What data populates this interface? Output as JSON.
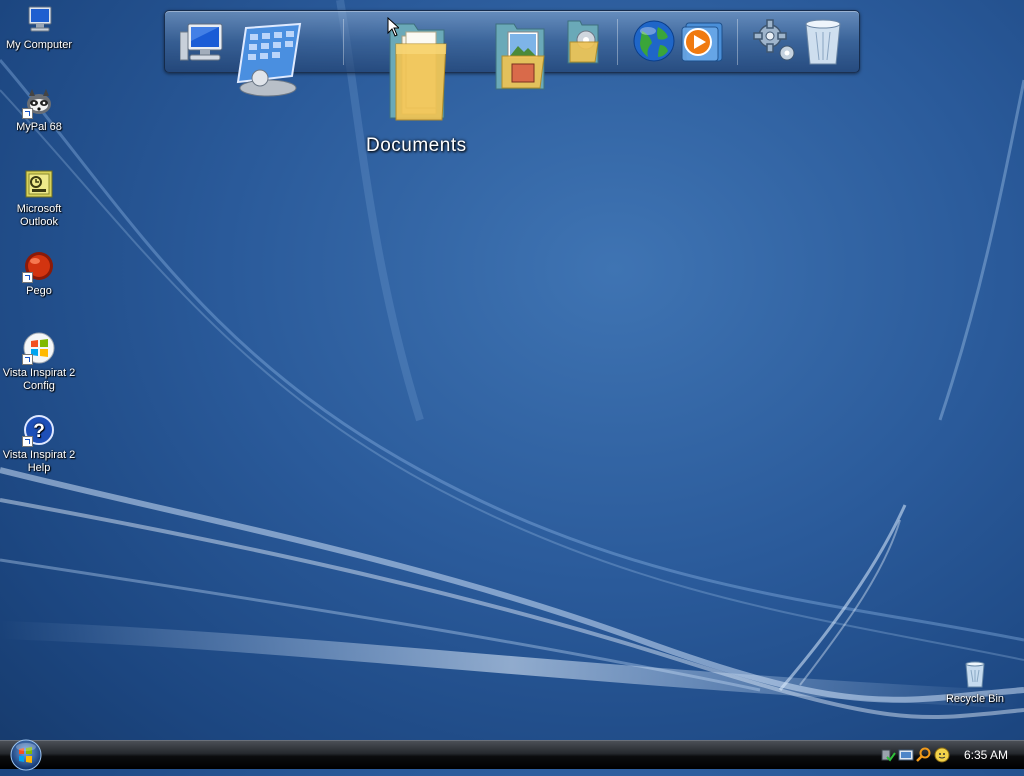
{
  "desktop": {
    "icons": [
      {
        "label": "My Computer",
        "icon": "computer-icon"
      },
      {
        "label": "MyPal 68",
        "icon": "raccoon-icon"
      },
      {
        "label": "Microsoft Outlook",
        "icon": "outlook-icon"
      },
      {
        "label": "Pego",
        "icon": "pego-ball-icon"
      },
      {
        "label": "Vista Inspirat 2 Config",
        "icon": "windows-logo-icon"
      },
      {
        "label": "Vista Inspirat 2 Help",
        "icon": "help-icon"
      }
    ],
    "recycle_bin": {
      "label": "Recycle Bin",
      "icon": "recycle-bin-icon"
    }
  },
  "dock": {
    "items": [
      {
        "name": "computer",
        "icon": "computer-icon"
      },
      {
        "name": "control-panel",
        "icon": "control-panel-icon"
      },
      {
        "name": "documents",
        "icon": "documents-folder-icon"
      },
      {
        "name": "pictures",
        "icon": "pictures-folder-icon"
      },
      {
        "name": "music",
        "icon": "music-folder-icon"
      },
      {
        "name": "internet",
        "icon": "globe-icon"
      },
      {
        "name": "media-player",
        "icon": "media-player-icon"
      },
      {
        "name": "settings",
        "icon": "gears-icon"
      },
      {
        "name": "trash",
        "icon": "recycle-bin-icon"
      }
    ],
    "hover_label": "Documents"
  },
  "taskbar": {
    "start_icon": "windows-orb-icon",
    "tray_icons": [
      "safely-remove-icon",
      "network-icon",
      "search-icon",
      "messenger-icon"
    ],
    "clock": "6:35 AM"
  },
  "colors": {
    "background": "#2a5a9a",
    "taskbar": "#0b0c0e",
    "text": "#ffffff"
  }
}
